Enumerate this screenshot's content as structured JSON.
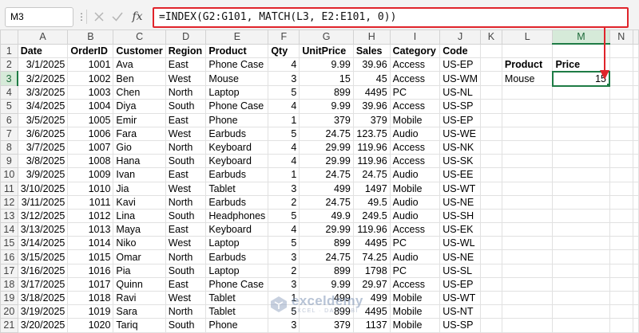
{
  "formula_bar": {
    "cell_ref": "M3",
    "fx_label": "fx",
    "formula": "=INDEX(G2:G101, MATCH(L3, E2:E101, 0))"
  },
  "sheet": {
    "columns": [
      "A",
      "B",
      "C",
      "D",
      "E",
      "F",
      "G",
      "H",
      "I",
      "J",
      "K",
      "L",
      "M",
      "N"
    ],
    "selected_column": "M",
    "selected_row": "3",
    "headers": [
      "Date",
      "OrderID",
      "Customer",
      "Region",
      "Product",
      "Qty",
      "UnitPrice",
      "Sales",
      "Category",
      "Code"
    ],
    "rows": [
      [
        "3/1/2025",
        "1001",
        "Ava",
        "East",
        "Phone Case",
        "4",
        "9.99",
        "39.96",
        "Access",
        "US-EP"
      ],
      [
        "3/2/2025",
        "1002",
        "Ben",
        "West",
        "Mouse",
        "3",
        "15",
        "45",
        "Access",
        "US-WM"
      ],
      [
        "3/3/2025",
        "1003",
        "Chen",
        "North",
        "Laptop",
        "5",
        "899",
        "4495",
        "PC",
        "US-NL"
      ],
      [
        "3/4/2025",
        "1004",
        "Diya",
        "South",
        "Phone Case",
        "4",
        "9.99",
        "39.96",
        "Access",
        "US-SP"
      ],
      [
        "3/5/2025",
        "1005",
        "Emir",
        "East",
        "Phone",
        "1",
        "379",
        "379",
        "Mobile",
        "US-EP"
      ],
      [
        "3/6/2025",
        "1006",
        "Fara",
        "West",
        "Earbuds",
        "5",
        "24.75",
        "123.75",
        "Audio",
        "US-WE"
      ],
      [
        "3/7/2025",
        "1007",
        "Gio",
        "North",
        "Keyboard",
        "4",
        "29.99",
        "119.96",
        "Access",
        "US-NK"
      ],
      [
        "3/8/2025",
        "1008",
        "Hana",
        "South",
        "Keyboard",
        "4",
        "29.99",
        "119.96",
        "Access",
        "US-SK"
      ],
      [
        "3/9/2025",
        "1009",
        "Ivan",
        "East",
        "Earbuds",
        "1",
        "24.75",
        "24.75",
        "Audio",
        "US-EE"
      ],
      [
        "3/10/2025",
        "1010",
        "Jia",
        "West",
        "Tablet",
        "3",
        "499",
        "1497",
        "Mobile",
        "US-WT"
      ],
      [
        "3/11/2025",
        "1011",
        "Kavi",
        "North",
        "Earbuds",
        "2",
        "24.75",
        "49.5",
        "Audio",
        "US-NE"
      ],
      [
        "3/12/2025",
        "1012",
        "Lina",
        "South",
        "Headphones",
        "5",
        "49.9",
        "249.5",
        "Audio",
        "US-SH"
      ],
      [
        "3/13/2025",
        "1013",
        "Maya",
        "East",
        "Keyboard",
        "4",
        "29.99",
        "119.96",
        "Access",
        "US-EK"
      ],
      [
        "3/14/2025",
        "1014",
        "Niko",
        "West",
        "Laptop",
        "5",
        "899",
        "4495",
        "PC",
        "US-WL"
      ],
      [
        "3/15/2025",
        "1015",
        "Omar",
        "North",
        "Earbuds",
        "3",
        "24.75",
        "74.25",
        "Audio",
        "US-NE"
      ],
      [
        "3/16/2025",
        "1016",
        "Pia",
        "South",
        "Laptop",
        "2",
        "899",
        "1798",
        "PC",
        "US-SL"
      ],
      [
        "3/17/2025",
        "1017",
        "Quinn",
        "East",
        "Phone Case",
        "3",
        "9.99",
        "29.97",
        "Access",
        "US-EP"
      ],
      [
        "3/18/2025",
        "1018",
        "Ravi",
        "West",
        "Tablet",
        "1",
        "499",
        "499",
        "Mobile",
        "US-WT"
      ],
      [
        "3/19/2025",
        "1019",
        "Sara",
        "North",
        "Tablet",
        "5",
        "899",
        "4495",
        "Mobile",
        "US-NT"
      ],
      [
        "3/20/2025",
        "1020",
        "Tariq",
        "South",
        "Phone",
        "3",
        "379",
        "1137",
        "Mobile",
        "US-SP"
      ]
    ],
    "lookup": {
      "product_label": "Product",
      "price_label": "Price",
      "product_value": "Mouse",
      "price_value": "15"
    }
  },
  "watermark": {
    "name": "exceldemy",
    "tagline": "EXCEL · DATA · BI"
  },
  "colors": {
    "accent_green": "#1e7b45",
    "highlight_red": "#e0242b"
  }
}
